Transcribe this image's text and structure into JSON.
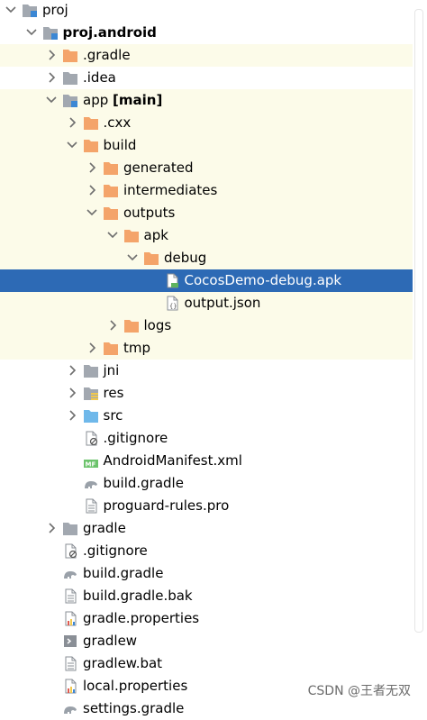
{
  "colors": {
    "highlight_row": "#fcfbe9",
    "selection": "#2d6ab5",
    "folder_orange": "#f4a46a",
    "folder_gray": "#a2a8b0",
    "folder_blue": "#6fb8ea"
  },
  "tree": [
    {
      "label": "proj",
      "bold": "",
      "indent": 0,
      "arrow": "expanded",
      "icon": "module-folder-icon",
      "hl": false,
      "sel": false
    },
    {
      "label": "proj.android",
      "bold": "",
      "indent": 1,
      "arrow": "expanded",
      "icon": "module-folder-icon",
      "hl": false,
      "sel": false,
      "labelBold": true
    },
    {
      "label": ".gradle",
      "bold": "",
      "indent": 2,
      "arrow": "collapsed",
      "icon": "folder-orange-icon",
      "hl": true,
      "sel": false
    },
    {
      "label": ".idea",
      "bold": "",
      "indent": 2,
      "arrow": "collapsed",
      "icon": "folder-gray-icon",
      "hl": false,
      "sel": false
    },
    {
      "label": "app ",
      "bold": "[main]",
      "indent": 2,
      "arrow": "expanded",
      "icon": "module-folder-icon",
      "hl": true,
      "sel": false
    },
    {
      "label": ".cxx",
      "bold": "",
      "indent": 3,
      "arrow": "collapsed",
      "icon": "folder-orange-icon",
      "hl": true,
      "sel": false
    },
    {
      "label": "build",
      "bold": "",
      "indent": 3,
      "arrow": "expanded",
      "icon": "folder-orange-icon",
      "hl": true,
      "sel": false
    },
    {
      "label": "generated",
      "bold": "",
      "indent": 4,
      "arrow": "collapsed",
      "icon": "folder-orange-icon",
      "hl": true,
      "sel": false
    },
    {
      "label": "intermediates",
      "bold": "",
      "indent": 4,
      "arrow": "collapsed",
      "icon": "folder-orange-icon",
      "hl": true,
      "sel": false
    },
    {
      "label": "outputs",
      "bold": "",
      "indent": 4,
      "arrow": "expanded",
      "icon": "folder-orange-icon",
      "hl": true,
      "sel": false
    },
    {
      "label": "apk",
      "bold": "",
      "indent": 5,
      "arrow": "expanded",
      "icon": "folder-orange-icon",
      "hl": true,
      "sel": false
    },
    {
      "label": "debug",
      "bold": "",
      "indent": 6,
      "arrow": "expanded",
      "icon": "folder-orange-icon",
      "hl": true,
      "sel": false
    },
    {
      "label": "CocosDemo-debug.apk",
      "bold": "",
      "indent": 7,
      "arrow": "none",
      "icon": "apk-file-icon",
      "hl": false,
      "sel": true
    },
    {
      "label": "output.json",
      "bold": "",
      "indent": 7,
      "arrow": "none",
      "icon": "json-file-icon",
      "hl": true,
      "sel": false
    },
    {
      "label": "logs",
      "bold": "",
      "indent": 5,
      "arrow": "collapsed",
      "icon": "folder-orange-icon",
      "hl": true,
      "sel": false
    },
    {
      "label": "tmp",
      "bold": "",
      "indent": 4,
      "arrow": "collapsed",
      "icon": "folder-orange-icon",
      "hl": true,
      "sel": false
    },
    {
      "label": "jni",
      "bold": "",
      "indent": 3,
      "arrow": "collapsed",
      "icon": "folder-gray-icon",
      "hl": false,
      "sel": false
    },
    {
      "label": "res",
      "bold": "",
      "indent": 3,
      "arrow": "collapsed",
      "icon": "res-folder-icon",
      "hl": false,
      "sel": false
    },
    {
      "label": "src",
      "bold": "",
      "indent": 3,
      "arrow": "collapsed",
      "icon": "folder-blue-icon",
      "hl": false,
      "sel": false
    },
    {
      "label": ".gitignore",
      "bold": "",
      "indent": 3,
      "arrow": "none",
      "icon": "gitignore-file-icon",
      "hl": false,
      "sel": false
    },
    {
      "label": "AndroidManifest.xml",
      "bold": "",
      "indent": 3,
      "arrow": "none",
      "icon": "manifest-file-icon",
      "hl": false,
      "sel": false
    },
    {
      "label": "build.gradle",
      "bold": "",
      "indent": 3,
      "arrow": "none",
      "icon": "gradle-file-icon",
      "hl": false,
      "sel": false
    },
    {
      "label": "proguard-rules.pro",
      "bold": "",
      "indent": 3,
      "arrow": "none",
      "icon": "text-file-icon",
      "hl": false,
      "sel": false
    },
    {
      "label": "gradle",
      "bold": "",
      "indent": 2,
      "arrow": "collapsed",
      "icon": "folder-gray-icon",
      "hl": false,
      "sel": false
    },
    {
      "label": ".gitignore",
      "bold": "",
      "indent": 2,
      "arrow": "none",
      "icon": "gitignore-file-icon",
      "hl": false,
      "sel": false
    },
    {
      "label": "build.gradle",
      "bold": "",
      "indent": 2,
      "arrow": "none",
      "icon": "gradle-file-icon",
      "hl": false,
      "sel": false
    },
    {
      "label": "build.gradle.bak",
      "bold": "",
      "indent": 2,
      "arrow": "none",
      "icon": "text-file-icon",
      "hl": false,
      "sel": false
    },
    {
      "label": "gradle.properties",
      "bold": "",
      "indent": 2,
      "arrow": "none",
      "icon": "properties-file-icon",
      "hl": false,
      "sel": false
    },
    {
      "label": "gradlew",
      "bold": "",
      "indent": 2,
      "arrow": "none",
      "icon": "shell-file-icon",
      "hl": false,
      "sel": false
    },
    {
      "label": "gradlew.bat",
      "bold": "",
      "indent": 2,
      "arrow": "none",
      "icon": "text-file-icon",
      "hl": false,
      "sel": false
    },
    {
      "label": "local.properties",
      "bold": "",
      "indent": 2,
      "arrow": "none",
      "icon": "properties-file-icon",
      "hl": false,
      "sel": false
    },
    {
      "label": "settings.gradle",
      "bold": "",
      "indent": 2,
      "arrow": "none",
      "icon": "gradle-file-icon",
      "hl": false,
      "sel": false
    }
  ],
  "watermark": "CSDN @王者无双"
}
